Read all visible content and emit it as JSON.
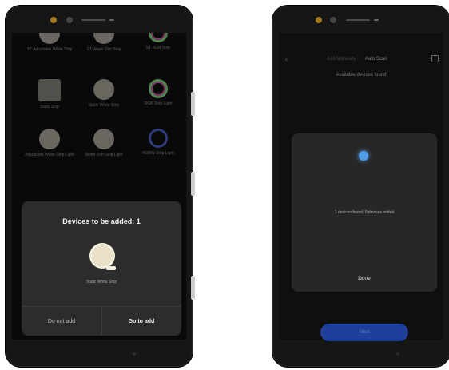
{
  "left_screen": {
    "grid_items": [
      {
        "label": "ST Adjustable White Strip",
        "icon": "round-light-icon"
      },
      {
        "label": "ST Warm Dim Strip",
        "icon": "round-light-icon"
      },
      {
        "label": "ST RGB Strip",
        "icon": "rgb-ring-icon"
      },
      {
        "label": "Static Strip",
        "icon": "square-light-icon"
      },
      {
        "label": "Static White Strip",
        "icon": "round-light-icon"
      },
      {
        "label": "RGB Strip Light",
        "icon": "rgb-ring-icon"
      },
      {
        "label": "Adjustable White Strip Light",
        "icon": "round-light-icon"
      },
      {
        "label": "Warm Dim Strip Light",
        "icon": "round-light-icon"
      },
      {
        "label": "RGBW Strip Light",
        "icon": "blue-ring-icon"
      }
    ],
    "sheet": {
      "title": "Devices to be added: 1",
      "device_label": "Static White Strip",
      "cancel_label": "Do not add",
      "confirm_label": "Go to add"
    }
  },
  "right_screen": {
    "tabs": {
      "manual": "Add Manually",
      "auto": "Auto Scan"
    },
    "subtitle": "Available devices found",
    "result_text": "1 devices found, 0 devices added",
    "done_label": "Done",
    "next_label": "Next"
  },
  "colors": {
    "bluetooth": "#4f9ee6",
    "next_button": "#1e3f9c"
  }
}
